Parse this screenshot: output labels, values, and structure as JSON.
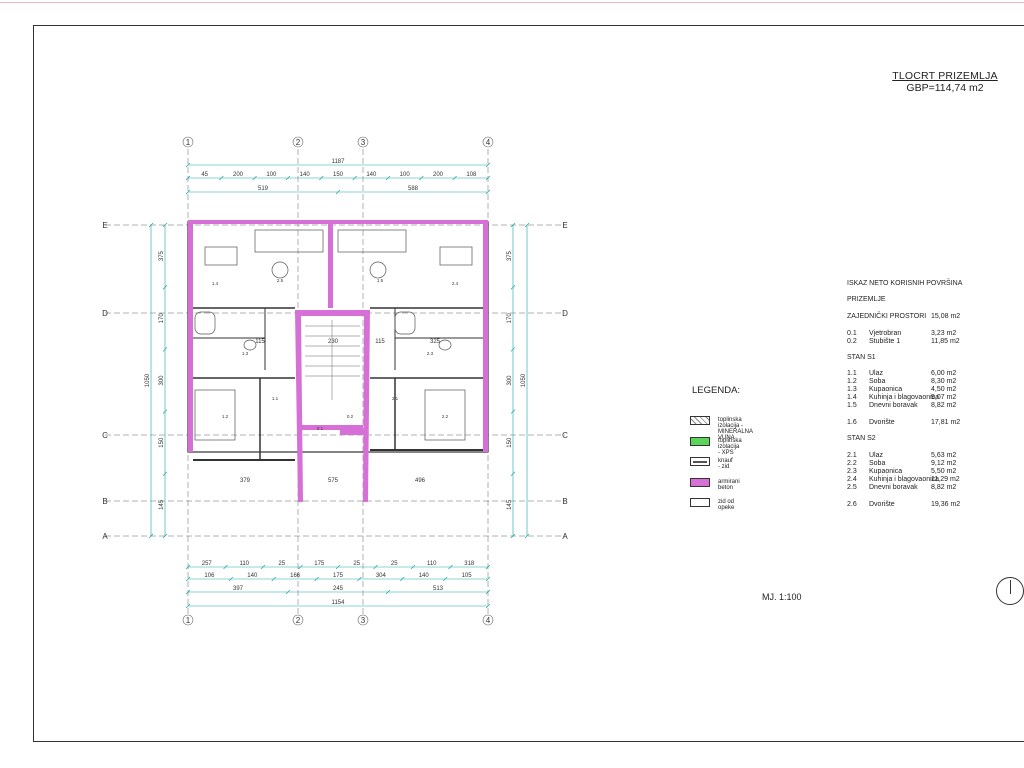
{
  "title": {
    "line1": "TLOCRT PRIZEMLJA",
    "line2": "GBP=114,74 m2"
  },
  "scale": "MJ. 1:100",
  "north_icon": "north-arrow-icon",
  "areas": {
    "title": "ISKAZ NETO KORISNIH POVRŠINA",
    "floor": "PRIZEMLJE",
    "common": {
      "label": "ZAJEDNIČKI PROSTORI",
      "total": "15,08 m2",
      "rows": [
        {
          "no": "0.1",
          "name": "Vjetrobran",
          "area": "3,23  m2"
        },
        {
          "no": "0.2",
          "name": "Stubište 1",
          "area": "11,85 m2"
        }
      ]
    },
    "s1": {
      "label": "STAN S1",
      "rows": [
        {
          "no": "1.1",
          "name": "Ulaz",
          "area": "6,00 m2"
        },
        {
          "no": "1.2",
          "name": "Soba",
          "area": "8,30  m2"
        },
        {
          "no": "1.3",
          "name": "Kupaonica",
          "area": "4,50  m2"
        },
        {
          "no": "1.4",
          "name": "Kuhinja i blagovaonica",
          "area": "9,07  m2"
        },
        {
          "no": "1.5",
          "name": "Dnevni boravak",
          "area": "8,82    m2"
        }
      ],
      "yard": {
        "no": "1.6",
        "name": "Dvorište",
        "area": "17,81 m2"
      }
    },
    "s2": {
      "label": "STAN S2",
      "rows": [
        {
          "no": "2.1",
          "name": "Ulaz",
          "area": "5,63 m2"
        },
        {
          "no": "2.2",
          "name": "Soba",
          "area": "9,12  m2"
        },
        {
          "no": "2.3",
          "name": "Kupaonica",
          "area": "5,50  m2"
        },
        {
          "no": "2.4",
          "name": "Kuhinja i blagovaonica",
          "area": "11,29 m2"
        },
        {
          "no": "2.5",
          "name": "Dnevni boravak",
          "area": "8,82  m2"
        }
      ],
      "yard": {
        "no": "2.6",
        "name": "Dvorište",
        "area": "19,36 m2"
      }
    }
  },
  "legend": {
    "title": "LEGENDA:",
    "items": [
      {
        "label": "toplinska izolacija - MINERALNA VUNA",
        "color": "#ffffff"
      },
      {
        "label": "toplinska izolacija - XPS",
        "color": "#5bd65b"
      },
      {
        "label": "knauf - zid",
        "color": "#555555"
      },
      {
        "label": "armirani beton",
        "color": "#d670d6"
      },
      {
        "label": "zid od opeke",
        "color": "#ffffff"
      }
    ]
  },
  "plan": {
    "col_axes": [
      "1",
      "2",
      "3",
      "4"
    ],
    "row_axes": [
      "E",
      "D",
      "C",
      "B",
      "A"
    ],
    "dims": {
      "top_total": "1187",
      "top_parts": [
        "519",
        "588"
      ],
      "top_detail": [
        "45",
        "200",
        "100",
        "140",
        "150",
        "140",
        "100",
        "200",
        "108"
      ],
      "bottom_chain1": [
        "257",
        "110",
        "25",
        "175",
        "25",
        "25",
        "110",
        "318"
      ],
      "bottom_chain2": [
        "106",
        "140",
        "166",
        "175",
        "304",
        "140",
        "105"
      ],
      "bottom_chain3": [
        "397",
        "245",
        "513"
      ],
      "bottom_total": "1154",
      "inner": [
        "115",
        "230",
        "115",
        "325",
        "379",
        "575",
        "496"
      ],
      "left": [
        "375",
        "170",
        "300",
        "150",
        "145",
        "1050"
      ],
      "right": [
        "375",
        "170",
        "300",
        "150",
        "145",
        "1050"
      ]
    },
    "room_tags": [
      "2.5",
      "1.5",
      "1.4",
      "2.4",
      "1.3",
      "2.3",
      "1.1",
      "2.1",
      "1.2",
      "2.2",
      "0.1",
      "0.2"
    ],
    "colors": {
      "concrete": "#d670d6",
      "wall": "#333333",
      "dim": "#1aa7a7",
      "axis": "#666666",
      "insulation": "#5bd65b"
    }
  }
}
